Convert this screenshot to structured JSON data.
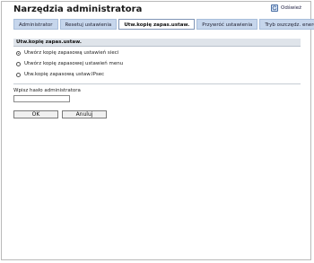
{
  "header": {
    "title": "Narzędzia administratora",
    "refresh_label": "Odśwież"
  },
  "tabs": [
    {
      "label": "Administrator"
    },
    {
      "label": "Resetuj ustawienia"
    },
    {
      "label": "Utw.kopię zapas.ustaw."
    },
    {
      "label": "Przywróć ustawienia"
    },
    {
      "label": "Tryb oszczędz. energii"
    }
  ],
  "active_tab": "Utw.kopię zapas.ustaw.",
  "section": {
    "title": "Utw.kopię zapas.ustaw.",
    "options": [
      {
        "label": "Utwórz kopię zapasową ustawień sieci",
        "checked": true
      },
      {
        "label": "Utwórz kopię zapasowej ustawień menu",
        "checked": false
      },
      {
        "label": "Utw.kopię zapasową ustaw.IPsec",
        "checked": false
      }
    ]
  },
  "password": {
    "label": "Wpisz hasło administratora",
    "value": ""
  },
  "buttons": {
    "ok": "OK",
    "cancel": "Anuluj"
  }
}
